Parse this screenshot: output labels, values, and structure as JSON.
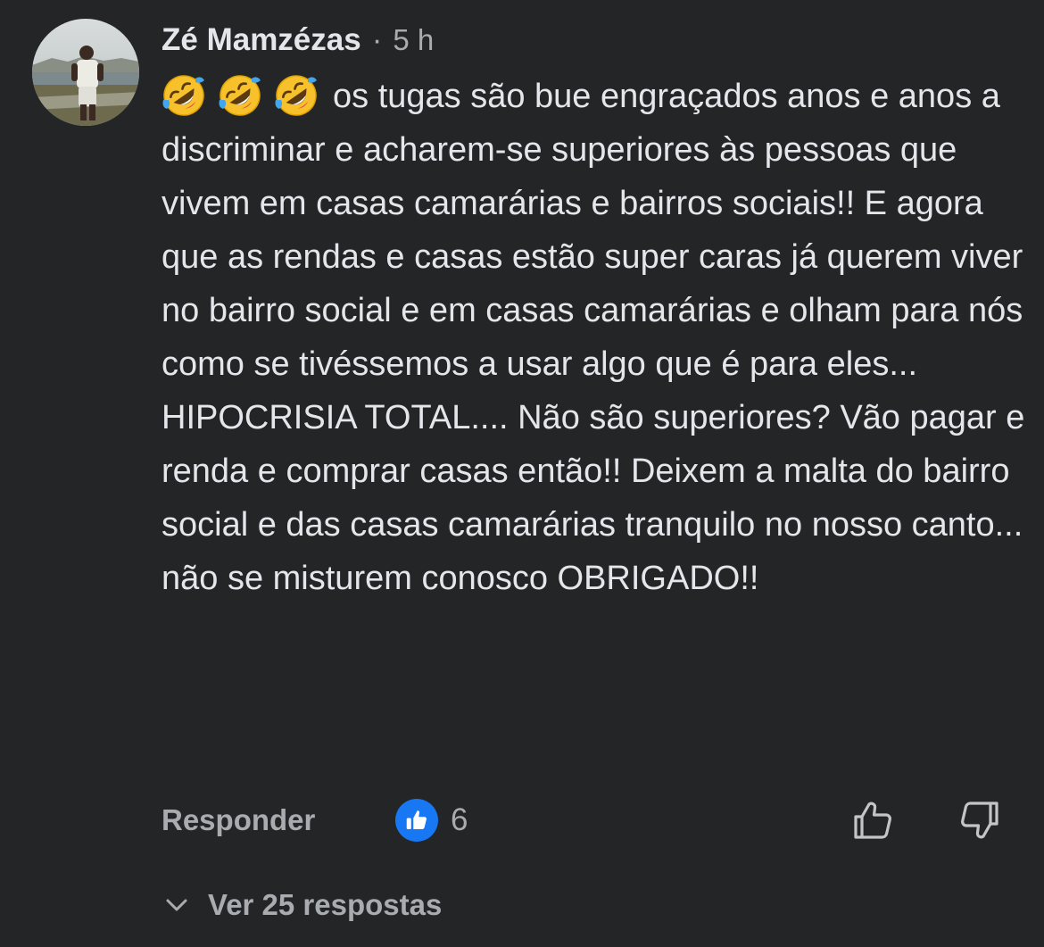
{
  "comment": {
    "author": "Zé Mamzézas",
    "separator": "·",
    "time": "5 h",
    "emojis": [
      "rolling-on-floor-laughing-emoji",
      "rolling-on-floor-laughing-emoji",
      "rolling-on-floor-laughing-emoji"
    ],
    "text": "os tugas são bue engraçados anos e anos a discriminar e acharem-se superiores às pessoas que vivem em casas camarárias e bairros sociais!! E agora que as rendas e casas estão super caras já querem viver no bairro social e em casas camarárias e olham para nós como se tivéssemos a usar algo que é para eles... HIPOCRISIA TOTAL.... Não são superiores? Vão pagar e renda e comprar casas então!! Deixem a malta do bairro social e das casas camarárias tranquilo no nosso canto... não se misturem conosco OBRIGADO!!",
    "reply_label": "Responder",
    "reaction_count": "6",
    "view_replies_label": "Ver 25 respostas"
  },
  "icons": {
    "like_badge": "like-thumb-icon",
    "upvote": "thumb-up-outline-icon",
    "downvote": "thumb-down-outline-icon",
    "expand": "chevron-down-icon"
  },
  "colors": {
    "background": "#242526",
    "primary_text": "#e4e6eb",
    "secondary_text": "#a8abaf",
    "like_blue": "#1877f2"
  }
}
